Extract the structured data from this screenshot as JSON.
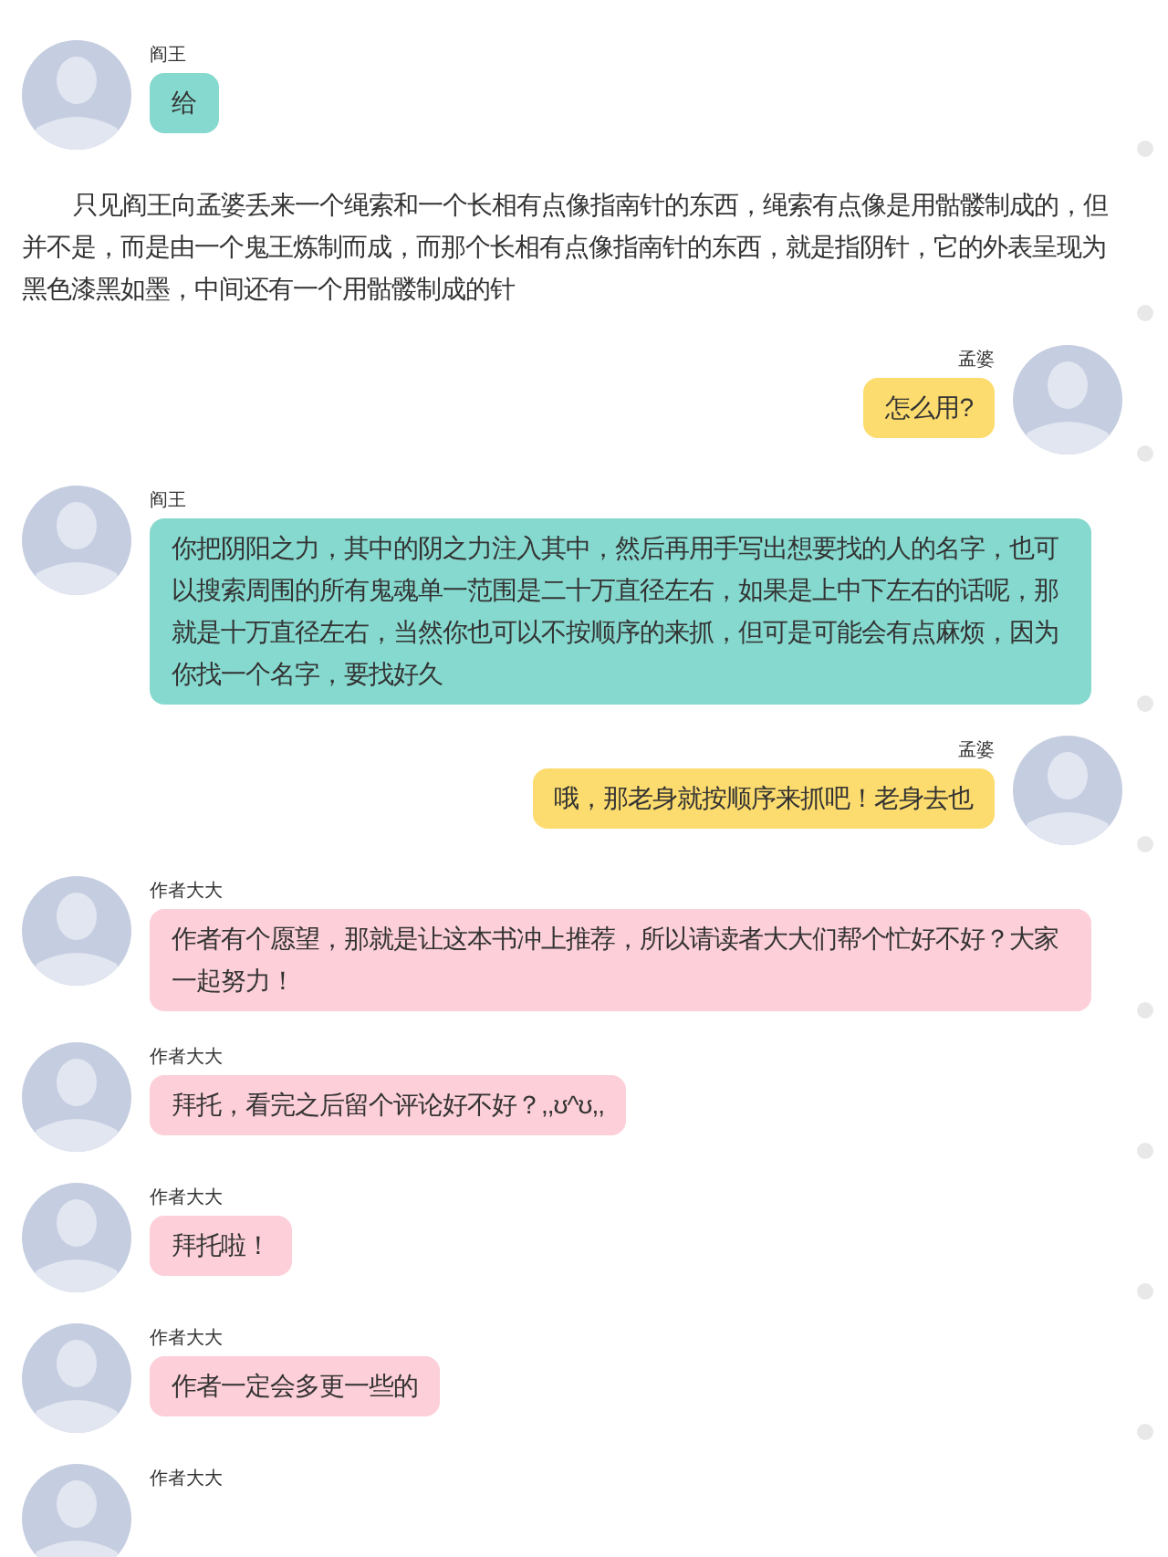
{
  "messages": [
    {
      "kind": "incoming",
      "name": "阎王",
      "text": "给",
      "color": "#86d9cf"
    },
    {
      "kind": "narration",
      "text": "只见阎王向孟婆丢来一个绳索和一个长相有点像指南针的东西，绳索有点像是用骷髅制成的，但并不是，而是由一个鬼王炼制而成，而那个长相有点像指南针的东西，就是指阴针，它的外表呈现为黑色漆黑如墨，中间还有一个用骷髅制成的针"
    },
    {
      "kind": "outgoing",
      "name": "孟婆",
      "text": "怎么用?",
      "color": "#fcdc6e"
    },
    {
      "kind": "incoming",
      "name": "阎王",
      "text": "你把阴阳之力，其中的阴之力注入其中，然后再用手写出想要找的人的名字，也可以搜索周围的所有鬼魂单一范围是二十万直径左右，如果是上中下左右的话呢，那就是十万直径左右，当然你也可以不按顺序的来抓，但可是可能会有点麻烦，因为你找一个名字，要找好久",
      "color": "#86d9cf"
    },
    {
      "kind": "outgoing",
      "name": "孟婆",
      "text": "哦，那老身就按顺序来抓吧！老身去也",
      "color": "#fcdc6e"
    },
    {
      "kind": "incoming",
      "name": "作者大大",
      "text": "作者有个愿望，那就是让这本书冲上推荐，所以请读者大大们帮个忙好不好？大家一起努力！",
      "color": "#fccfd9"
    },
    {
      "kind": "incoming",
      "name": "作者大大",
      "text": "拜托，看完之后留个评论好不好？,,ʊ^ʊ,,",
      "color": "#fccfd9"
    },
    {
      "kind": "incoming",
      "name": "作者大大",
      "text": "拜托啦！",
      "color": "#fccfd9"
    },
    {
      "kind": "incoming",
      "name": "作者大大",
      "text": "作者一定会多更一些的",
      "color": "#fccfd9"
    },
    {
      "kind": "incoming",
      "name": "作者大大"
    }
  ]
}
